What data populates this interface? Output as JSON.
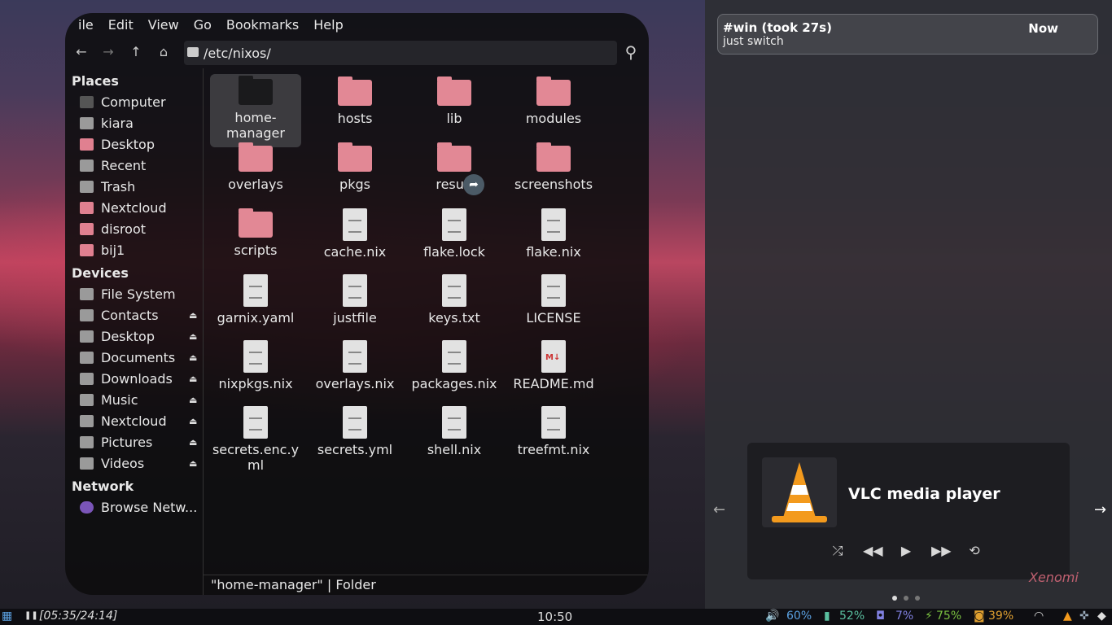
{
  "menu": [
    "ile",
    "Edit",
    "View",
    "Go",
    "Bookmarks",
    "Help"
  ],
  "path": "/etc/nixos/",
  "places_title": "Places",
  "places": [
    "Computer",
    "kiara",
    "Desktop",
    "Recent",
    "Trash",
    "Nextcloud",
    "disroot",
    "bij1"
  ],
  "devices_title": "Devices",
  "devices": [
    "File System",
    "Contacts",
    "Desktop",
    "Documents",
    "Downloads",
    "Music",
    "Nextcloud",
    "Pictures",
    "Videos"
  ],
  "network_title": "Network",
  "network": [
    "Browse Netw..."
  ],
  "files": [
    "home-\nmanager",
    "hosts",
    "lib",
    "modules",
    "overlays",
    "pkgs",
    "result",
    "screenshots",
    "scripts",
    "cache.nix",
    "flake.lock",
    "flake.nix",
    "garnix.yaml",
    "justfile",
    "keys.txt",
    "LICENSE",
    "nixpkgs.nix",
    "overlays.nix",
    "packages.nix",
    "README.md",
    "secrets.enc.y\nml",
    "secrets.yml",
    "shell.nix",
    "treefmt.nix"
  ],
  "status": "\"home-manager\"  |  Folder",
  "notification": {
    "title": "#win (took 27s)",
    "time": "Now",
    "body": "just switch"
  },
  "player": {
    "name": "VLC media player"
  },
  "signature": "Xenomi",
  "taskbar": {
    "pause": "❚❚",
    "elapsed": "[05:35/24:14]",
    "clock": "10:50",
    "volume": "60%",
    "mem": "52%",
    "cpu": "7%",
    "battery": "75%",
    "disk": "39%"
  },
  "colors": {
    "folder": "#e28895",
    "accent_blue": "#5aa0e0",
    "battery_green": "#7ac040",
    "disk_orange": "#e0a030"
  }
}
